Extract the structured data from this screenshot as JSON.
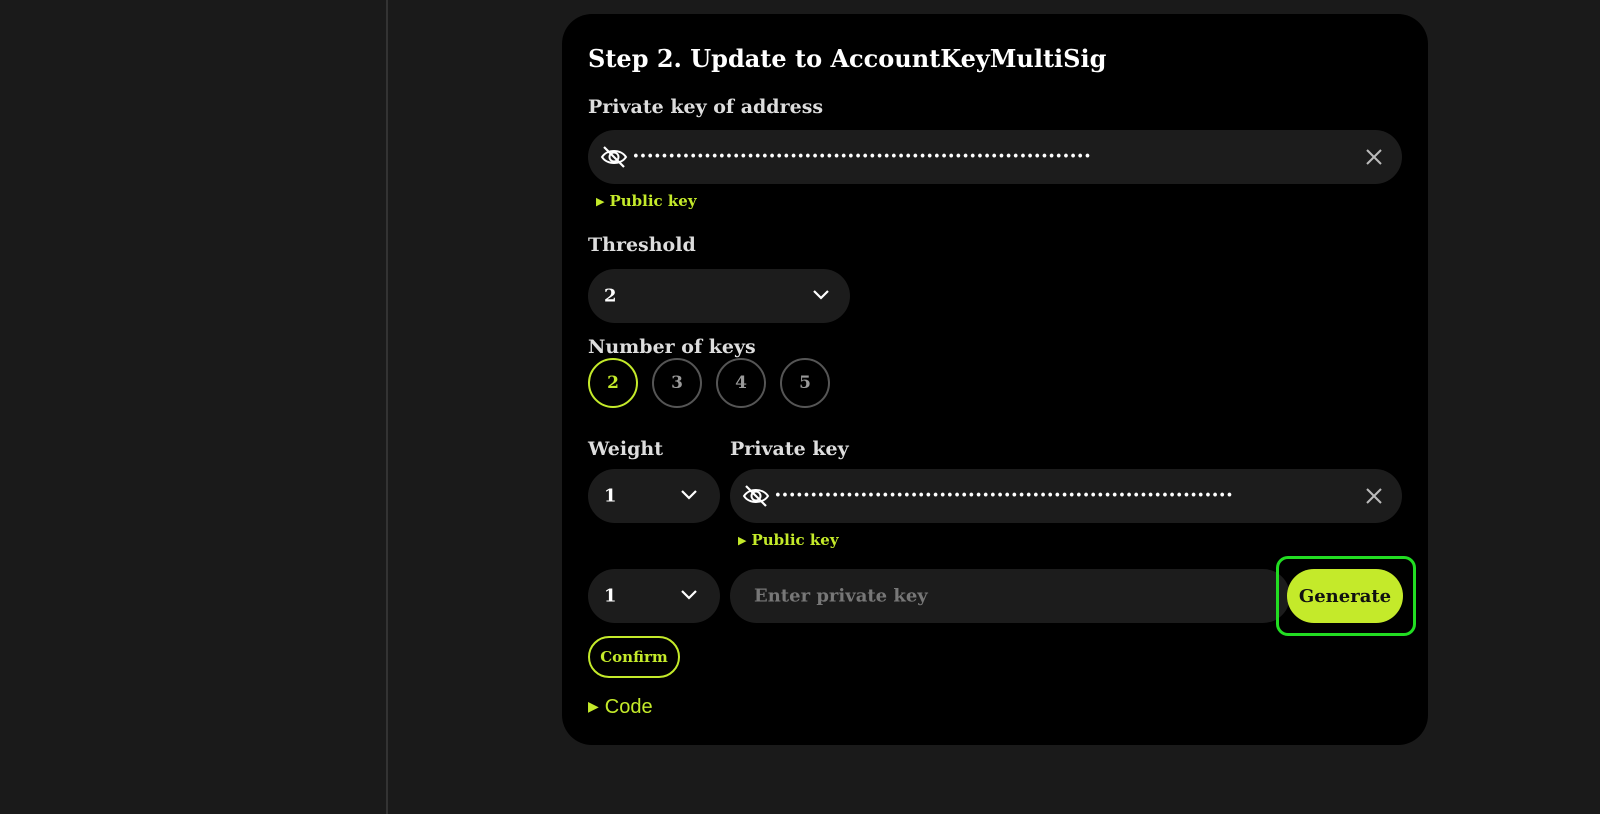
{
  "step": {
    "title": "Step 2. Update to AccountKeyMultiSig"
  },
  "address_key": {
    "label": "Private key of address",
    "masked_value": "••••••••••••••••••••••••••••••••••••••••••••••••••••••••••••••••",
    "public_key_toggle": "Public key"
  },
  "threshold": {
    "label": "Threshold",
    "selected": "2"
  },
  "num_keys": {
    "label": "Number of keys",
    "options": [
      "2",
      "3",
      "4",
      "5"
    ],
    "selected": "2"
  },
  "keys_table": {
    "weight_label": "Weight",
    "private_key_label": "Private key",
    "rows": [
      {
        "weight": "1",
        "masked_value": "••••••••••••••••••••••••••••••••••••••••••••••••••••••••••••••••",
        "public_key_toggle": "Public key"
      },
      {
        "weight": "1",
        "placeholder": "Enter private key",
        "generate_label": "Generate"
      }
    ]
  },
  "confirm_label": "Confirm",
  "code_toggle": "Code",
  "colors": {
    "accent": "#c4ea2a",
    "highlight": "#22dd22",
    "card_bg": "#000000",
    "page_bg": "#1a1a1a",
    "field_bg": "#1c1c1c"
  },
  "icons": [
    "eye-off-icon",
    "close-icon",
    "chevron-down-icon",
    "triangle-right-icon"
  ]
}
